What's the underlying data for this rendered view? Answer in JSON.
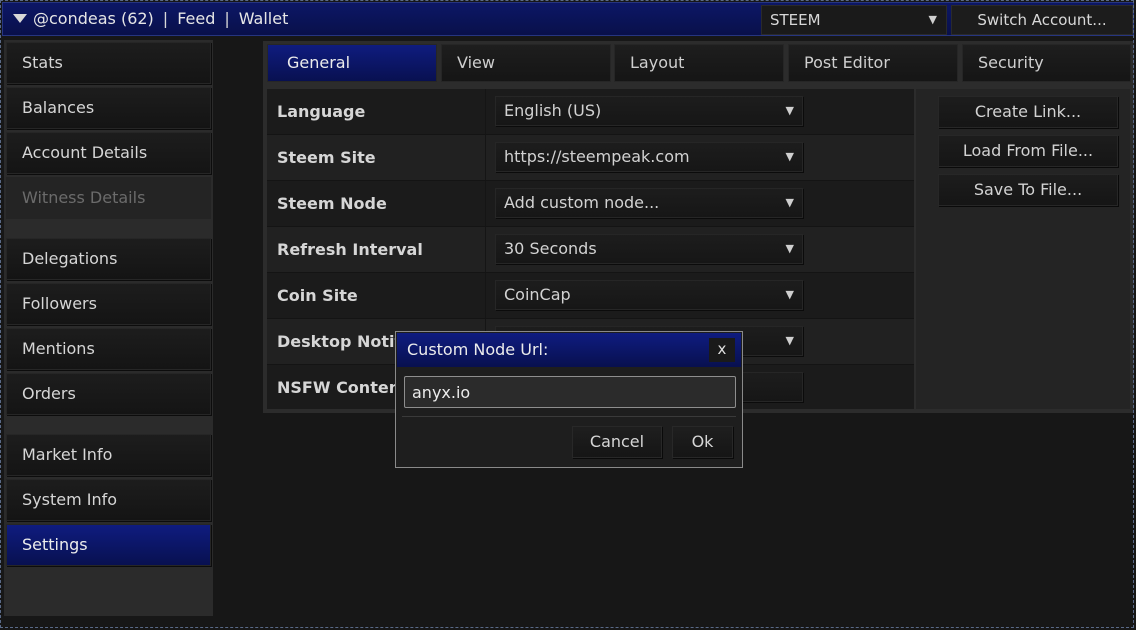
{
  "topbar": {
    "account": "@condeas (62)",
    "nav": [
      "Feed",
      "Wallet"
    ],
    "coin_selected": "STEEM",
    "switch_account": "Switch Account..."
  },
  "sidebar": {
    "items": [
      {
        "label": "Stats"
      },
      {
        "label": "Balances"
      },
      {
        "label": "Account Details"
      },
      {
        "label": "Witness Details"
      },
      {
        "label": "Delegations"
      },
      {
        "label": "Followers"
      },
      {
        "label": "Mentions"
      },
      {
        "label": "Orders"
      },
      {
        "label": "Market Info"
      },
      {
        "label": "System Info"
      },
      {
        "label": "Settings"
      }
    ]
  },
  "tabs": [
    "General",
    "View",
    "Layout",
    "Post Editor",
    "Security"
  ],
  "settings": [
    {
      "label": "Language",
      "value": "English (US)"
    },
    {
      "label": "Steem Site",
      "value": "https://steempeak.com"
    },
    {
      "label": "Steem Node",
      "value": "Add custom node..."
    },
    {
      "label": "Refresh Interval",
      "value": "30 Seconds"
    },
    {
      "label": "Coin Site",
      "value": "CoinCap"
    },
    {
      "label": "Desktop Notific",
      "value": ""
    },
    {
      "label": "NSFW Content",
      "value": ""
    }
  ],
  "actions": [
    "Create Link...",
    "Load From File...",
    "Save To File..."
  ],
  "dialog": {
    "title": "Custom Node Url:",
    "close": "x",
    "input_value": "anyx.io",
    "cancel": "Cancel",
    "ok": "Ok"
  },
  "icons": {
    "dropdown": "chevron-down-icon",
    "account_menu": "caret-down-icon"
  },
  "colors": {
    "accent": "#0c1766",
    "background": "#171717"
  }
}
